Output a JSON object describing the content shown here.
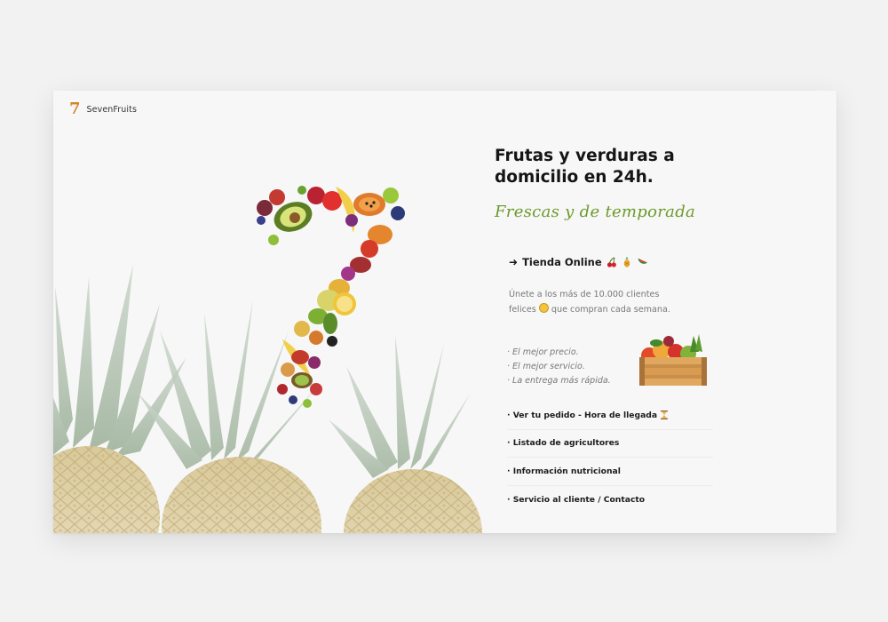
{
  "brand": {
    "name": "SevenFruits",
    "logo_glyph": "7"
  },
  "hero": {
    "headline": "Frutas y verduras a domicilio en 24h.",
    "tagline": "Frescas y de temporada"
  },
  "shop": {
    "arrow": "➜",
    "label": "Tienda Online",
    "icons": [
      "cherries-icon",
      "pineapple-icon",
      "watermelon-icon"
    ]
  },
  "description": {
    "part1": "Únete a los más de 10.000 clientes felices",
    "part2": "que compran cada semana."
  },
  "benefits": [
    "· El mejor precio.",
    "· El mejor servicio.",
    "· La entrega más rápida."
  ],
  "links": [
    {
      "label": "· Ver tu pedido - Hora de llegada"
    },
    {
      "label": "· Listado de agricultores"
    },
    {
      "label": "· Información nutricional"
    },
    {
      "label": "· Servicio al cliente / Contacto"
    }
  ],
  "colors": {
    "accent_green": "#6c9a2a",
    "logo_orange": "#d2872a",
    "text_dark": "#151515"
  }
}
